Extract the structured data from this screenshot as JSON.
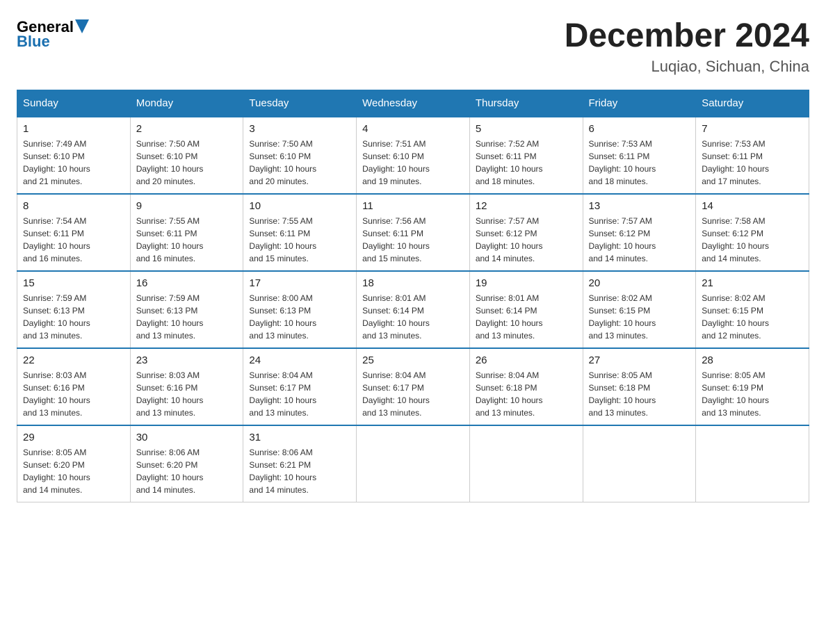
{
  "logo": {
    "general": "General",
    "blue": "Blue"
  },
  "header": {
    "title": "December 2024",
    "subtitle": "Luqiao, Sichuan, China"
  },
  "columns": [
    "Sunday",
    "Monday",
    "Tuesday",
    "Wednesday",
    "Thursday",
    "Friday",
    "Saturday"
  ],
  "weeks": [
    [
      {
        "day": "1",
        "sunrise": "7:49 AM",
        "sunset": "6:10 PM",
        "daylight": "10 hours and 21 minutes."
      },
      {
        "day": "2",
        "sunrise": "7:50 AM",
        "sunset": "6:10 PM",
        "daylight": "10 hours and 20 minutes."
      },
      {
        "day": "3",
        "sunrise": "7:50 AM",
        "sunset": "6:10 PM",
        "daylight": "10 hours and 20 minutes."
      },
      {
        "day": "4",
        "sunrise": "7:51 AM",
        "sunset": "6:10 PM",
        "daylight": "10 hours and 19 minutes."
      },
      {
        "day": "5",
        "sunrise": "7:52 AM",
        "sunset": "6:11 PM",
        "daylight": "10 hours and 18 minutes."
      },
      {
        "day": "6",
        "sunrise": "7:53 AM",
        "sunset": "6:11 PM",
        "daylight": "10 hours and 18 minutes."
      },
      {
        "day": "7",
        "sunrise": "7:53 AM",
        "sunset": "6:11 PM",
        "daylight": "10 hours and 17 minutes."
      }
    ],
    [
      {
        "day": "8",
        "sunrise": "7:54 AM",
        "sunset": "6:11 PM",
        "daylight": "10 hours and 16 minutes."
      },
      {
        "day": "9",
        "sunrise": "7:55 AM",
        "sunset": "6:11 PM",
        "daylight": "10 hours and 16 minutes."
      },
      {
        "day": "10",
        "sunrise": "7:55 AM",
        "sunset": "6:11 PM",
        "daylight": "10 hours and 15 minutes."
      },
      {
        "day": "11",
        "sunrise": "7:56 AM",
        "sunset": "6:11 PM",
        "daylight": "10 hours and 15 minutes."
      },
      {
        "day": "12",
        "sunrise": "7:57 AM",
        "sunset": "6:12 PM",
        "daylight": "10 hours and 14 minutes."
      },
      {
        "day": "13",
        "sunrise": "7:57 AM",
        "sunset": "6:12 PM",
        "daylight": "10 hours and 14 minutes."
      },
      {
        "day": "14",
        "sunrise": "7:58 AM",
        "sunset": "6:12 PM",
        "daylight": "10 hours and 14 minutes."
      }
    ],
    [
      {
        "day": "15",
        "sunrise": "7:59 AM",
        "sunset": "6:13 PM",
        "daylight": "10 hours and 13 minutes."
      },
      {
        "day": "16",
        "sunrise": "7:59 AM",
        "sunset": "6:13 PM",
        "daylight": "10 hours and 13 minutes."
      },
      {
        "day": "17",
        "sunrise": "8:00 AM",
        "sunset": "6:13 PM",
        "daylight": "10 hours and 13 minutes."
      },
      {
        "day": "18",
        "sunrise": "8:01 AM",
        "sunset": "6:14 PM",
        "daylight": "10 hours and 13 minutes."
      },
      {
        "day": "19",
        "sunrise": "8:01 AM",
        "sunset": "6:14 PM",
        "daylight": "10 hours and 13 minutes."
      },
      {
        "day": "20",
        "sunrise": "8:02 AM",
        "sunset": "6:15 PM",
        "daylight": "10 hours and 13 minutes."
      },
      {
        "day": "21",
        "sunrise": "8:02 AM",
        "sunset": "6:15 PM",
        "daylight": "10 hours and 12 minutes."
      }
    ],
    [
      {
        "day": "22",
        "sunrise": "8:03 AM",
        "sunset": "6:16 PM",
        "daylight": "10 hours and 13 minutes."
      },
      {
        "day": "23",
        "sunrise": "8:03 AM",
        "sunset": "6:16 PM",
        "daylight": "10 hours and 13 minutes."
      },
      {
        "day": "24",
        "sunrise": "8:04 AM",
        "sunset": "6:17 PM",
        "daylight": "10 hours and 13 minutes."
      },
      {
        "day": "25",
        "sunrise": "8:04 AM",
        "sunset": "6:17 PM",
        "daylight": "10 hours and 13 minutes."
      },
      {
        "day": "26",
        "sunrise": "8:04 AM",
        "sunset": "6:18 PM",
        "daylight": "10 hours and 13 minutes."
      },
      {
        "day": "27",
        "sunrise": "8:05 AM",
        "sunset": "6:18 PM",
        "daylight": "10 hours and 13 minutes."
      },
      {
        "day": "28",
        "sunrise": "8:05 AM",
        "sunset": "6:19 PM",
        "daylight": "10 hours and 13 minutes."
      }
    ],
    [
      {
        "day": "29",
        "sunrise": "8:05 AM",
        "sunset": "6:20 PM",
        "daylight": "10 hours and 14 minutes."
      },
      {
        "day": "30",
        "sunrise": "8:06 AM",
        "sunset": "6:20 PM",
        "daylight": "10 hours and 14 minutes."
      },
      {
        "day": "31",
        "sunrise": "8:06 AM",
        "sunset": "6:21 PM",
        "daylight": "10 hours and 14 minutes."
      },
      null,
      null,
      null,
      null
    ]
  ],
  "labels": {
    "sunrise": "Sunrise:",
    "sunset": "Sunset:",
    "daylight": "Daylight:"
  }
}
